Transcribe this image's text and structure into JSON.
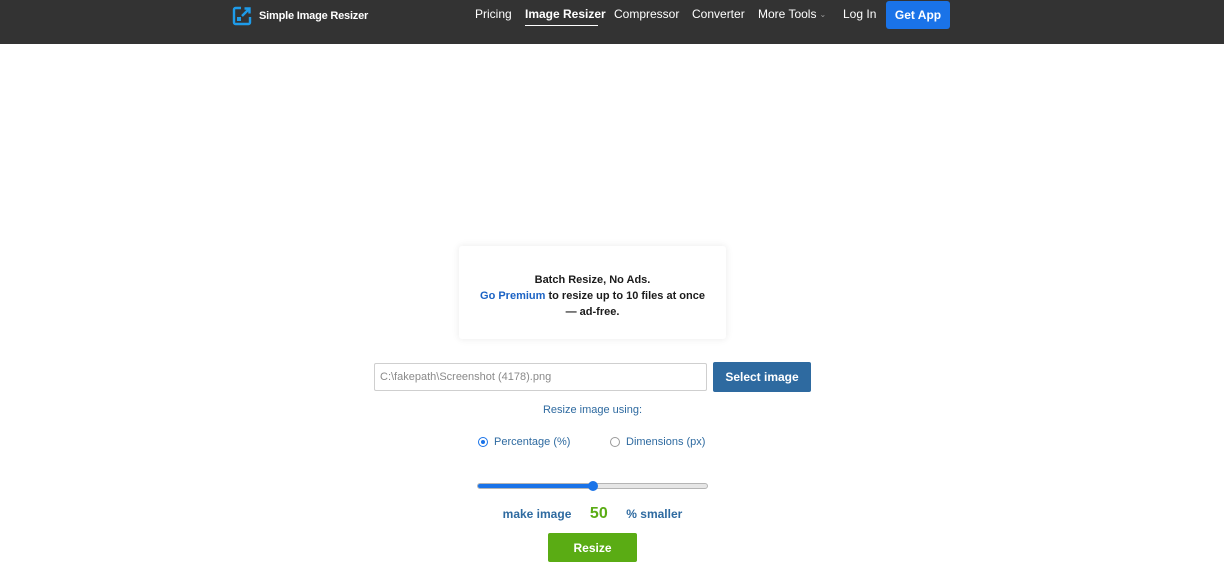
{
  "brand": {
    "name": "Simple Image Resizer",
    "icon": "resize-arrow-icon",
    "icon_color": "#1e9be9"
  },
  "nav": {
    "items": [
      "Pricing",
      "Image Resizer",
      "Compressor",
      "Converter",
      "More Tools",
      "Log In"
    ],
    "active": "Image Resizer",
    "cta": "Get App",
    "cta_color": "#1a73e8",
    "bar_color": "#333333"
  },
  "promo": {
    "headline": "Batch Resize, No Ads.",
    "link_text": "Go Premium",
    "body_line1": " to resize up to 10 files at once",
    "body_line2": "— ad-free."
  },
  "upload": {
    "file_value": "C:\\fakepath\\Screenshot (4178).png",
    "select_label": "Select image",
    "button_color": "#2e6aa0"
  },
  "resize": {
    "using_label": "Resize image using:",
    "options": [
      "Percentage (%)",
      "Dimensions (px)"
    ],
    "selected": "Percentage (%)",
    "slider_value_percent": 50,
    "make_label": "make image",
    "value": "50",
    "suffix": "% smaller",
    "button_label": "Resize",
    "accent_color": "#5aac14"
  }
}
